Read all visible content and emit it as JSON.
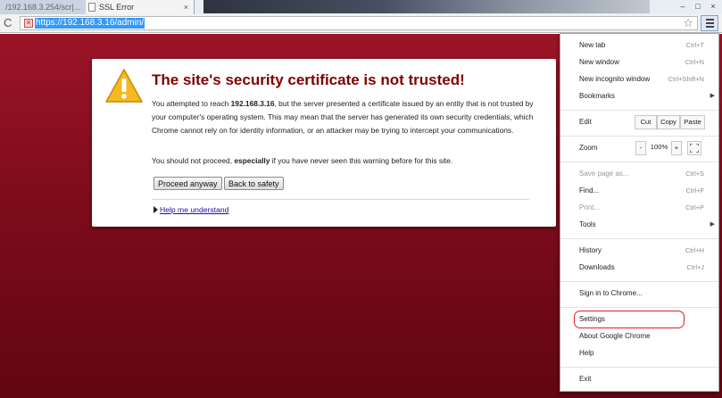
{
  "tabs": {
    "tab1_label": "/192.168.3.254/scr|...",
    "tab2_label": "SSL Error",
    "close": "×",
    "window_controls": [
      "–",
      "□",
      "×"
    ]
  },
  "omnibox": {
    "url": "https://192.168.3.16/admin/",
    "lock_glyph": "✕",
    "reload_glyph": "C",
    "star_glyph": "☆"
  },
  "card": {
    "title": "The site's security certificate is not trusted!",
    "para1_pre": "You attempted to reach ",
    "para1_host": "192.168.3.16",
    "para1_post": ", but the server presented a certificate issued by an entity that is not trusted by your computer's operating system. This may mean that the server has generated its own security credentials, which Chrome cannot rely on for identity information, or an attacker may be trying to intercept your communications.",
    "para2_pre": "You should not proceed, ",
    "para2_bold": "especially",
    "para2_post": " if you have never seen this warning before for this site.",
    "proceed_label": "Proceed anyway",
    "back_label": "Back to safety",
    "help_label": "Help me understand",
    "warn_color": "#f5b921"
  },
  "menu": {
    "new_tab": {
      "label": "New tab",
      "shortcut": "Ctrl+T"
    },
    "new_window": {
      "label": "New window",
      "shortcut": "Ctrl+N"
    },
    "new_incognito": {
      "label": "New incognito window",
      "shortcut": "Ctrl+Shift+N"
    },
    "bookmarks": {
      "label": "Bookmarks"
    },
    "edit": {
      "label": "Edit",
      "cut": "Cut",
      "copy": "Copy",
      "paste": "Paste"
    },
    "zoom": {
      "label": "Zoom",
      "minus": "-",
      "value": "100%",
      "plus": "+"
    },
    "save_page": {
      "label": "Save page as...",
      "shortcut": "Ctrl+S"
    },
    "find": {
      "label": "Find...",
      "shortcut": "Ctrl+F"
    },
    "print": {
      "label": "Print...",
      "shortcut": "Ctrl+P"
    },
    "tools": {
      "label": "Tools"
    },
    "history": {
      "label": "History",
      "shortcut": "Ctrl+H"
    },
    "downloads": {
      "label": "Downloads",
      "shortcut": "Ctrl+J"
    },
    "sign_in": {
      "label": "Sign in to Chrome..."
    },
    "settings": {
      "label": "Settings"
    },
    "about": {
      "label": "About Google Chrome"
    },
    "help": {
      "label": "Help"
    },
    "exit": {
      "label": "Exit"
    },
    "submenu_arrow": "▶",
    "highlight_color": "#e0202a"
  },
  "colors": {
    "page_bg": "#8b0f20",
    "title_color": "#800000",
    "link_color": "#1a0dab"
  }
}
